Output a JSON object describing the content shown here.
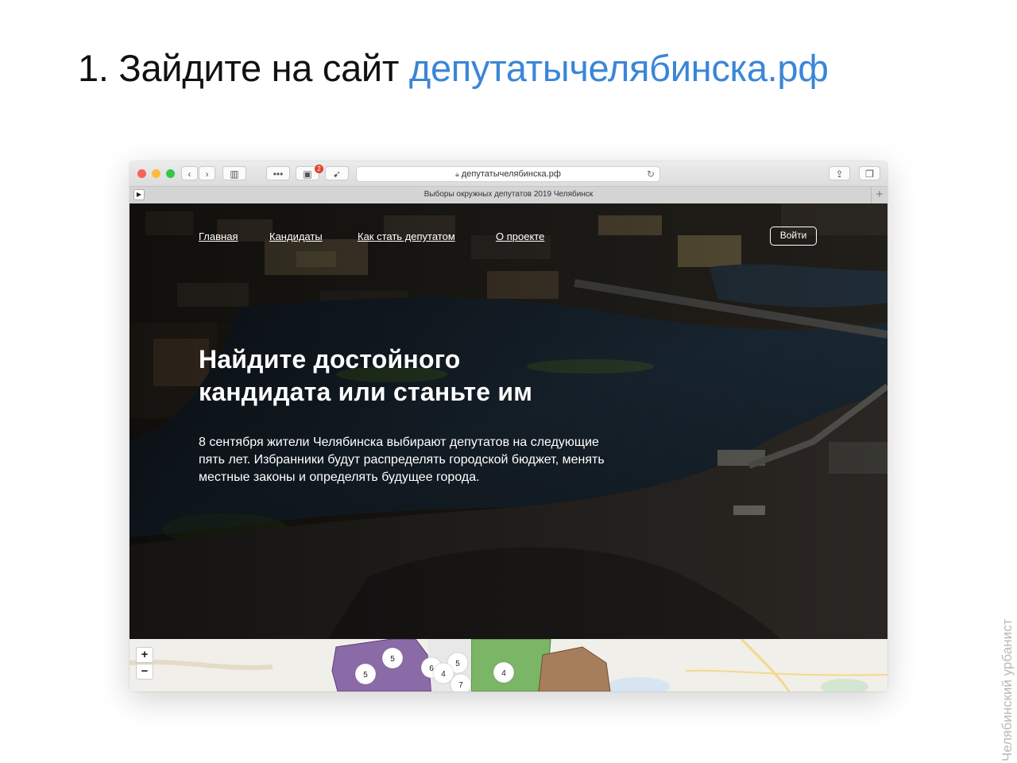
{
  "slide": {
    "title_prefix": "1. Зайдите на сайт ",
    "title_link": "депутатычелябинска.рф",
    "accent_color": "#3a86d8",
    "watermark": "Челябинский урбанист"
  },
  "browser": {
    "url": "депутатычелябинска.рф",
    "tab_title": "Выборы окружных депутатов 2019 Челябинск",
    "badge_count": "2",
    "icons": [
      "back-icon",
      "forward-icon",
      "sidebar-icon",
      "more-icon",
      "extensions-icon",
      "bookmark-icon",
      "lock-icon",
      "reload-icon",
      "share-icon",
      "tabs-icon",
      "audio-icon",
      "plus-icon"
    ]
  },
  "site": {
    "nav": [
      "Главная",
      "Кандидаты",
      "Как стать депутатом",
      "О проекте"
    ],
    "login": "Войти",
    "headline_line1": "Найдите достойного",
    "headline_line2": "кандидата или станьте им",
    "lead": "8 сентября жители Челябинска выбирают депутатов на следующие пять лет. Избранники будут распределять городской бюджет, менять местные законы и определять будущее города."
  },
  "map": {
    "zoom_in": "+",
    "zoom_out": "−",
    "clusters": [
      "5",
      "5",
      "6",
      "4",
      "5",
      "7",
      "4"
    ]
  }
}
